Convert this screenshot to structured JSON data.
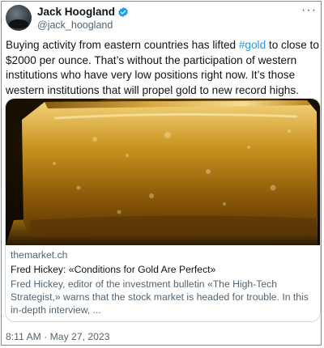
{
  "author": {
    "name": "Jack Hoogland",
    "handle": "@jack_hoogland"
  },
  "tweet": {
    "text_before": "Buying activity from eastern countries has lifted ",
    "hashtag": "#gold",
    "text_after": " to close to $2000 per ounce. That’s without the participation of western institutions who have very low positions right now. It’s those western institutions that will propel gold to new record highs."
  },
  "card": {
    "domain": "themarket.ch",
    "title": "Fred Hickey: «Conditions for Gold Are Perfect»",
    "description": "Fred Hickey, editor of the investment bulletin «The High-Tech Strategist,» warns that the stock market is headed for trouble. In this in-depth interview, ..."
  },
  "timestamp": "8:11 AM · May 27, 2023",
  "colors": {
    "link": "#1d9bf0",
    "secondary_text": "#536471",
    "card_border": "#cfd9de"
  },
  "icons": {
    "verified": "verified-badge-icon",
    "more": "more-options-icon"
  }
}
